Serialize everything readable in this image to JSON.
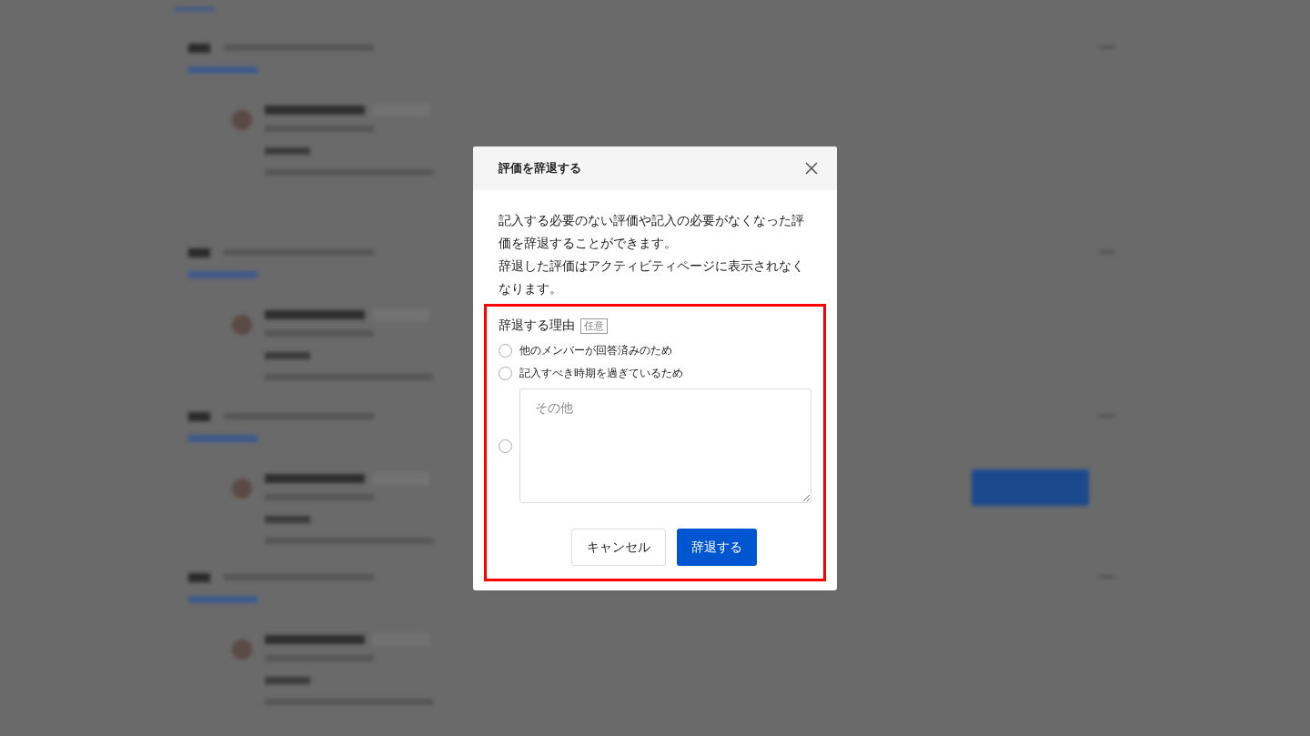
{
  "dialog": {
    "title": "評価を辞退する",
    "description": [
      "記入する必要のない評価や記入の必要がなくなった評価を辞退することができます。",
      "辞退した評価はアクティビティページに表示されなくなります。"
    ],
    "reason": {
      "label": "辞退する理由",
      "badge": "任意",
      "options": [
        {
          "kind": "radio",
          "label": "他のメンバーが回答済みのため",
          "selected": false
        },
        {
          "kind": "radio",
          "label": "記入すべき時期を過ぎているため",
          "selected": false
        },
        {
          "kind": "other",
          "placeholder": "その他",
          "selected": false
        }
      ]
    },
    "buttons": [
      {
        "kind": "secondary",
        "label": "キャンセル"
      },
      {
        "kind": "primary",
        "label": "辞退する"
      }
    ]
  }
}
